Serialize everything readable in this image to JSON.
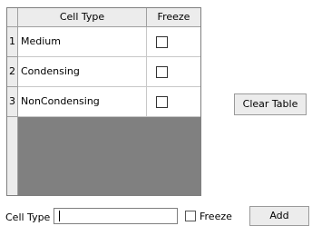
{
  "grid": {
    "columns": [
      "Cell Type",
      "Freeze"
    ],
    "rows": [
      {
        "num": "1",
        "type": "Medium",
        "freeze": false
      },
      {
        "num": "2",
        "type": "Condensing",
        "freeze": false
      },
      {
        "num": "3",
        "type": "NonCondensing",
        "freeze": false
      }
    ]
  },
  "buttons": {
    "clear": "Clear Table",
    "add": "Add"
  },
  "form": {
    "cell_type_label": "Cell Type",
    "cell_type_value": "",
    "freeze_label": "Freeze",
    "freeze_checked": false
  },
  "colors": {
    "title": "#2f5bd8"
  }
}
